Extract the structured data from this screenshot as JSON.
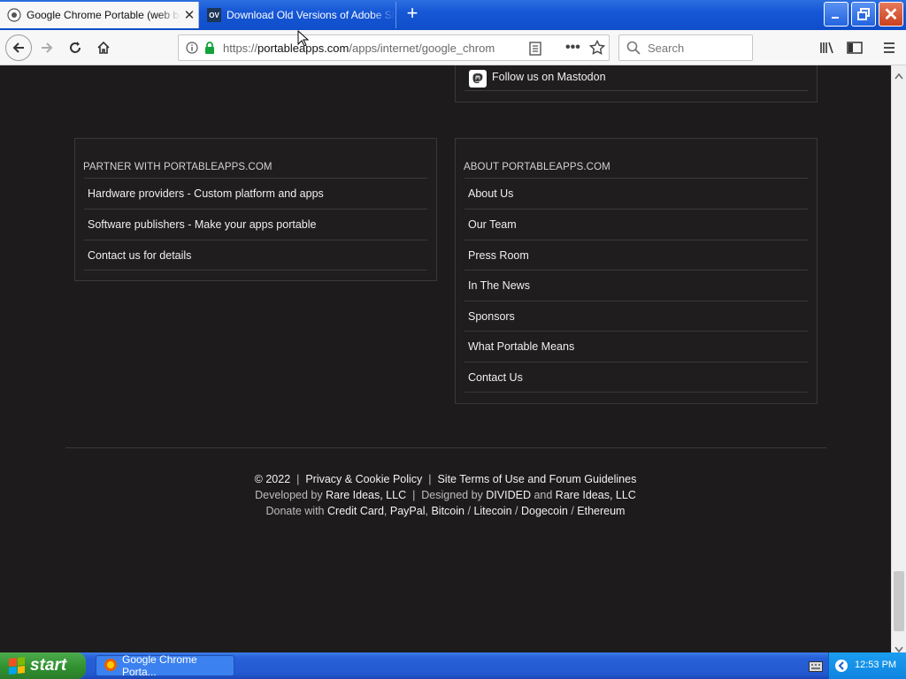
{
  "browser": {
    "tabs": [
      {
        "label": "Google Chrome Portable (web bro",
        "active": true,
        "favicon": "globe-icon"
      },
      {
        "label": "Download Old Versions of Adobe Shoc",
        "active": false,
        "favicon": "ov-icon",
        "favicon_text": "OV"
      }
    ],
    "new_tab_icon": "plus-icon",
    "url": {
      "scheme": "https://",
      "host": "portableapps.com",
      "path": "/apps/internet/google_chrom"
    },
    "search_placeholder": "Search"
  },
  "page": {
    "mastodon_link": "Follow us on Mastodon",
    "partner": {
      "heading": "PARTNER WITH PORTABLEAPPS.COM",
      "links": [
        "Hardware providers - Custom platform and apps",
        "Software publishers - Make your apps portable",
        "Contact us for details"
      ]
    },
    "about": {
      "heading": "ABOUT PORTABLEAPPS.COM",
      "links": [
        "About Us",
        "Our Team",
        "Press Room",
        "In The News",
        "Sponsors",
        "What Portable Means",
        "Contact Us"
      ]
    },
    "footer": {
      "copyright": "© 2022",
      "sep": "|",
      "privacy": "Privacy & Cookie Policy",
      "terms": "Site Terms of Use and Forum Guidelines",
      "developed_by": "Developed by",
      "rare_ideas": "Rare Ideas, LLC",
      "designed_by": "Designed by",
      "divided": "DIVIDED",
      "and": "and",
      "donate_with": "Donate with",
      "credit_card": "Credit Card",
      "paypal": "PayPal",
      "bitcoin": "Bitcoin",
      "litecoin": "Litecoin",
      "dogecoin": "Dogecoin",
      "ethereum": "Ethereum",
      "comma": ",",
      "slash": "/"
    }
  },
  "taskbar": {
    "start_label": "start",
    "task_label": "Google Chrome Porta...",
    "clock": "12:53 PM"
  },
  "colors": {
    "page_bg": "#1d1b1b",
    "xp_blue": "#2358d0",
    "start_green": "#2f8f2f"
  }
}
